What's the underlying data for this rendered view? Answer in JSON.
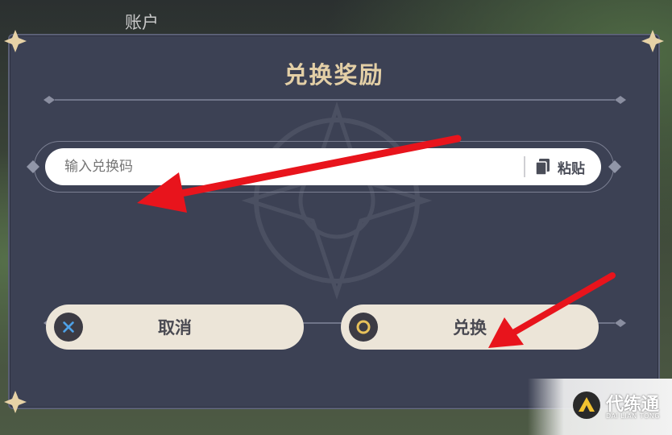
{
  "background": {
    "tab_label": "账户"
  },
  "dialog": {
    "title": "兑换奖励",
    "input": {
      "placeholder": "输入兑换码",
      "value": ""
    },
    "paste_label": "粘贴",
    "cancel_label": "取消",
    "confirm_label": "兑换"
  },
  "colors": {
    "dialog_bg": "#3c4154",
    "title": "#e3cfa6",
    "button_bg": "#ece5d8",
    "cancel_icon": "#4ea1e6",
    "confirm_icon": "#e8c15a",
    "annotation_arrow": "#e8141c"
  },
  "icons": {
    "cancel": "x-icon",
    "confirm": "circle-icon",
    "paste": "clipboard-icon"
  },
  "watermark": {
    "brand": "代练通",
    "sub": "DAI LIAN TONG"
  }
}
